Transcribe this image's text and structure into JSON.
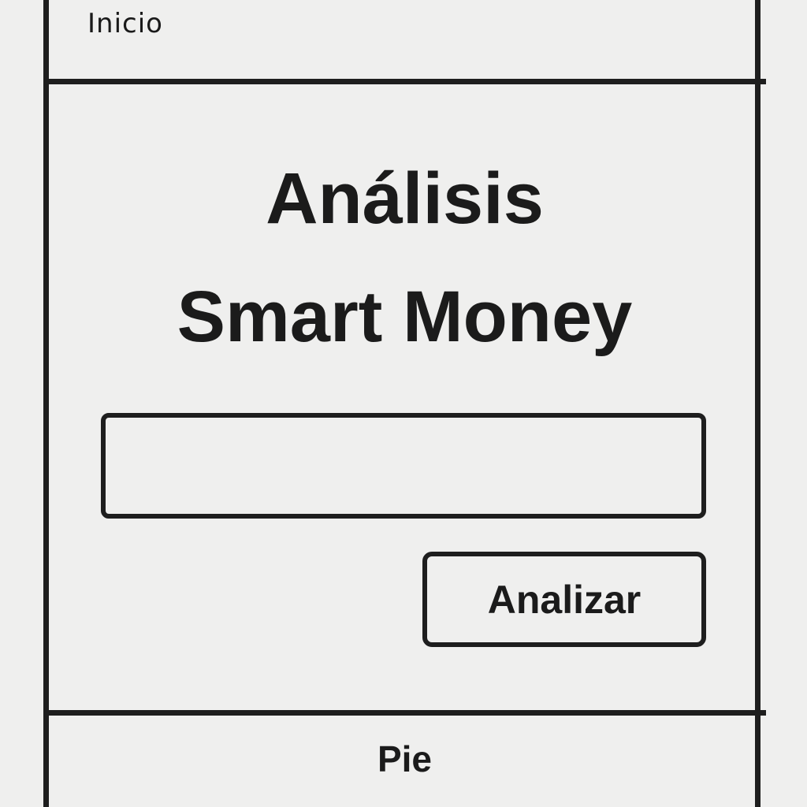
{
  "header": {
    "title": "Inicio"
  },
  "main": {
    "title_line1": "Análisis",
    "title_line2": "Smart Money",
    "input": {
      "value": "",
      "placeholder": ""
    },
    "analyze_label": "Analizar"
  },
  "footer": {
    "text": "Pie"
  },
  "colors": {
    "background": "#efefee",
    "line": "#1e1e1e",
    "text": "#1b1b1b"
  }
}
